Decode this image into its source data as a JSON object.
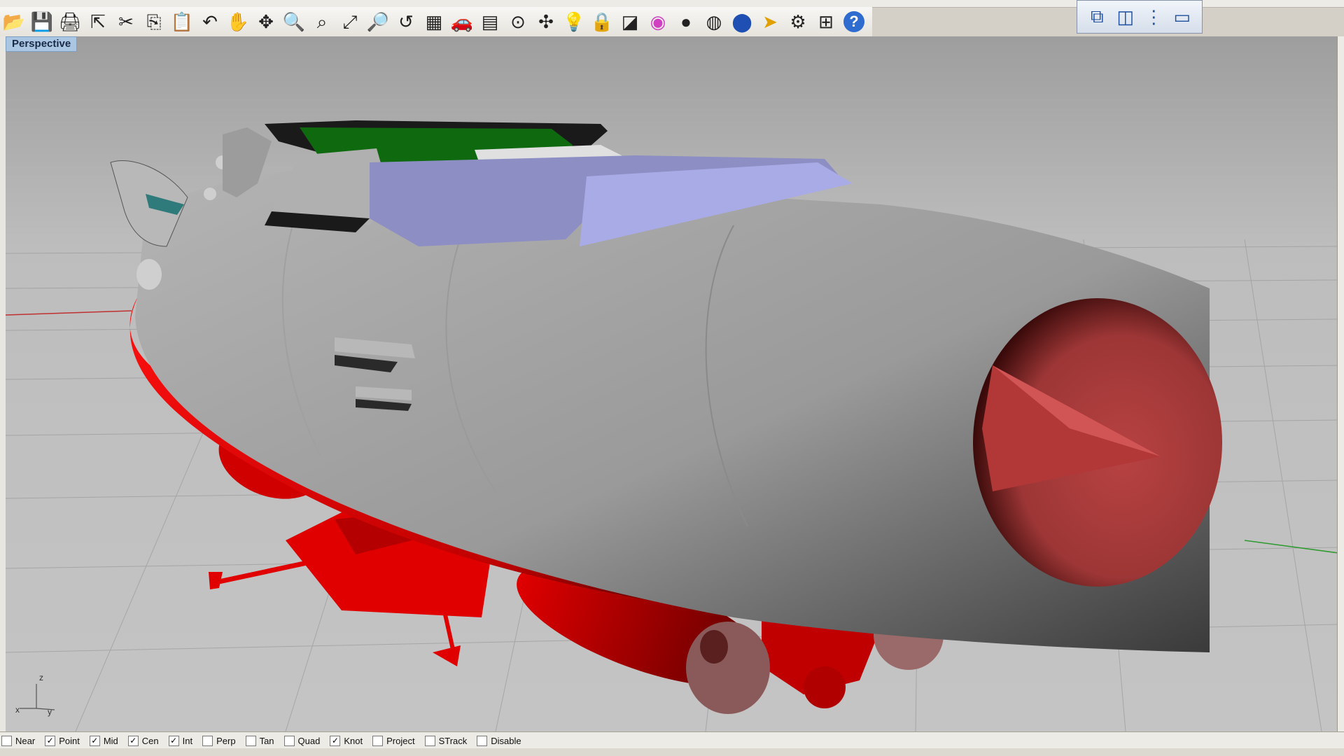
{
  "toolbar": {
    "icons": [
      "open-icon",
      "save-icon",
      "print-icon",
      "import-icon",
      "cut-icon",
      "copy-icon",
      "paste-icon",
      "undo-icon",
      "pan-icon",
      "rotate-view-icon",
      "zoom-icon",
      "zoom-window-icon",
      "zoom-extents-icon",
      "zoom-selected-icon",
      "undo-view-icon",
      "four-viewports-icon",
      "car-icon",
      "grid-icon",
      "circle-snap-icon",
      "gumball-icon",
      "light-icon",
      "lock-icon",
      "layer-icon",
      "color-wheel-icon",
      "shaded-sphere-icon",
      "wire-sphere-icon",
      "render-sphere-icon",
      "select-icon",
      "gear-icon",
      "dimension-icon",
      "help-icon"
    ]
  },
  "viewport_panel": {
    "icons": [
      "viewport-3d-icon",
      "viewport-split-icon",
      "viewport-vertical-icon",
      "viewport-max-icon"
    ]
  },
  "viewport": {
    "title": "Perspective",
    "axis_labels": {
      "x": "x",
      "y": "y",
      "z": "z"
    }
  },
  "colors": {
    "hull_gray": "#a9a9a9",
    "hull_red": "#e60000",
    "bridge_lavender": "#8e90c8",
    "deck_green": "#0f6a0f",
    "nozzle_red": "#b03a3a",
    "title_bg": "#aac6e3"
  },
  "osnap": [
    {
      "label": "Near",
      "checked": false
    },
    {
      "label": "Point",
      "checked": true
    },
    {
      "label": "Mid",
      "checked": true
    },
    {
      "label": "Cen",
      "checked": true
    },
    {
      "label": "Int",
      "checked": true
    },
    {
      "label": "Perp",
      "checked": false
    },
    {
      "label": "Tan",
      "checked": false
    },
    {
      "label": "Quad",
      "checked": false
    },
    {
      "label": "Knot",
      "checked": true
    },
    {
      "label": "Project",
      "checked": false
    },
    {
      "label": "STrack",
      "checked": false
    },
    {
      "label": "Disable",
      "checked": false
    }
  ]
}
